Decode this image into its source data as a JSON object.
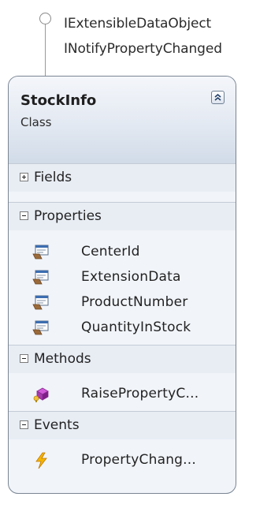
{
  "interfaces": [
    "IExtensibleDataObject",
    "INotifyPropertyChanged"
  ],
  "class": {
    "name": "StockInfo",
    "stereotype": "Class"
  },
  "compartments": {
    "fields": {
      "label": "Fields",
      "expanded": false
    },
    "properties": {
      "label": "Properties",
      "expanded": true,
      "items": [
        "CenterId",
        "ExtensionData",
        "ProductNumber",
        "QuantityInStock"
      ]
    },
    "methods": {
      "label": "Methods",
      "expanded": true,
      "items": [
        "RaisePropertyC..."
      ]
    },
    "events": {
      "label": "Events",
      "expanded": true,
      "items": [
        "PropertyChang..."
      ]
    }
  },
  "icons": {
    "property": "property-icon",
    "method": "method-icon",
    "event": "event-icon",
    "collapse": "double-chevron-up-icon"
  },
  "colors": {
    "header_gradient_top": "#f4f6fa",
    "header_gradient_bottom": "#d1dbe8",
    "compartment_bg": "#e8edf4",
    "border": "#7a8592"
  }
}
